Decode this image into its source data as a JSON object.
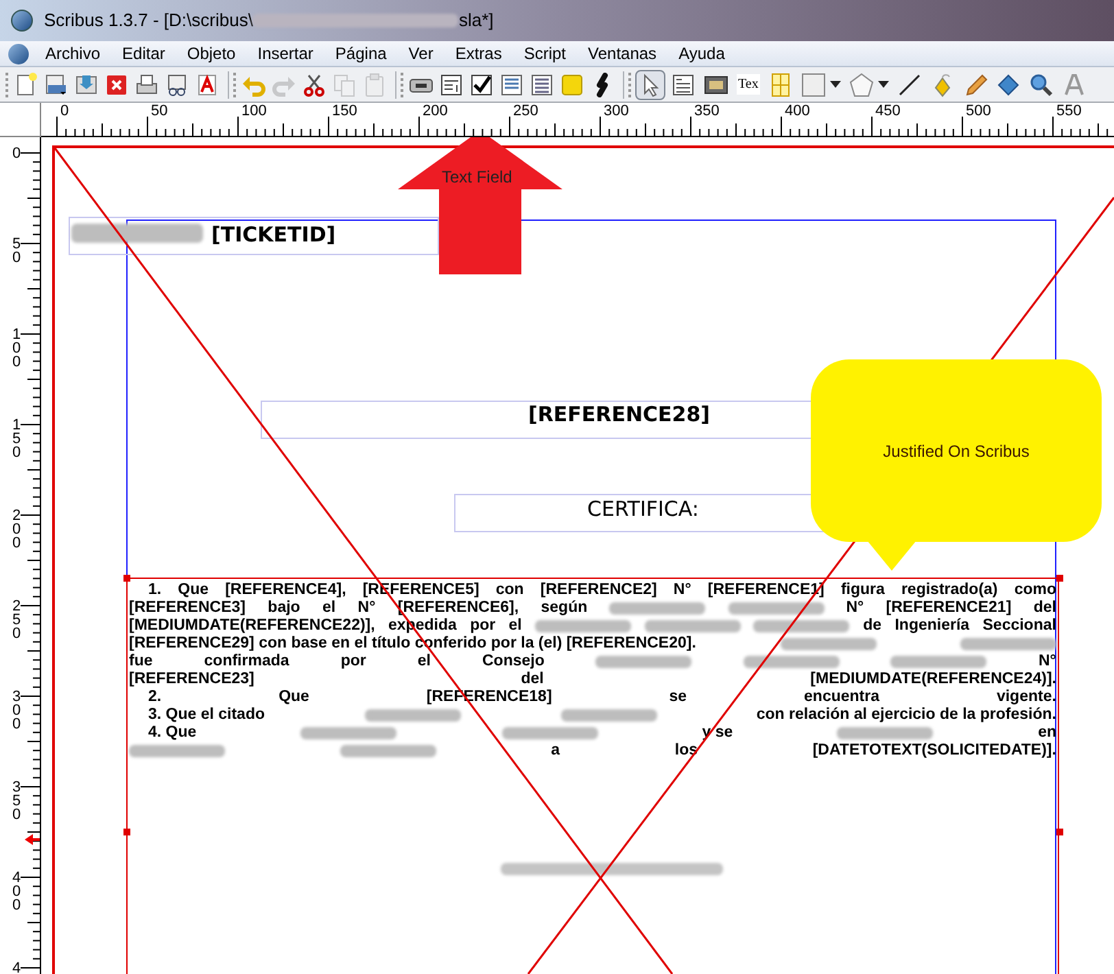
{
  "window": {
    "title_start": "Scribus 1.3.7 - [D:\\scribus\\",
    "title_end": "sla*]"
  },
  "menu": [
    "Archivo",
    "Editar",
    "Objeto",
    "Insertar",
    "Página",
    "Ver",
    "Extras",
    "Script",
    "Ventanas",
    "Ayuda"
  ],
  "toolbar": [
    [
      {
        "kind": "new"
      },
      {
        "kind": "open"
      },
      {
        "kind": "save"
      },
      {
        "kind": "close"
      },
      {
        "kind": "print"
      },
      {
        "kind": "preflight"
      },
      {
        "kind": "pdf"
      }
    ],
    [
      {
        "kind": "undo",
        "disabled": false
      },
      {
        "kind": "redo",
        "disabled": true
      },
      {
        "kind": "cut",
        "disabled": false
      },
      {
        "kind": "copy",
        "disabled": true
      },
      {
        "kind": "paste",
        "disabled": true
      }
    ],
    [
      {
        "kind": "pdf-button"
      },
      {
        "kind": "text-field"
      },
      {
        "kind": "checkbox"
      },
      {
        "kind": "combo-box"
      },
      {
        "kind": "list-box"
      },
      {
        "kind": "annotation"
      },
      {
        "kind": "link"
      }
    ],
    [
      {
        "kind": "select",
        "selected": true
      },
      {
        "kind": "text-frame",
        "selected": false
      },
      {
        "kind": "image-frame",
        "selected": false
      },
      {
        "kind": "latex",
        "label": "Tex",
        "selected": false
      },
      {
        "kind": "table",
        "selected": false
      },
      {
        "kind": "shape",
        "selected": false
      },
      {
        "kind": "polygon",
        "selected": false
      },
      {
        "kind": "line",
        "selected": false
      },
      {
        "kind": "bezier",
        "selected": false
      },
      {
        "kind": "freehand",
        "selected": false
      },
      {
        "kind": "rotate",
        "selected": false
      },
      {
        "kind": "zoom",
        "selected": false
      },
      {
        "kind": "edit-text",
        "selected": false
      }
    ]
  ],
  "rulers": {
    "horizontal": [
      "0",
      "50",
      "100",
      "150",
      "200",
      "250",
      "300",
      "350",
      "400",
      "450",
      "500",
      "550"
    ],
    "vertical": [
      "0",
      "50",
      "100",
      "150",
      "200",
      "250",
      "300",
      "350",
      "400",
      "4"
    ]
  },
  "page": {
    "ticket_field": "[TICKETID]",
    "arrow_label": "Text Field",
    "reference_field": "[REFERENCE28]",
    "certifica_field": "CERTIFICA:",
    "callout": "Justified On Scribus",
    "paragraph_lines": [
      {
        "indent": true,
        "segments": [
          {
            "kind": "text",
            "text": "1. Que [REFERENCE4], [REFERENCE5] con [REFERENCE2] N° [REFERENCE1] figura registrado(a) como"
          }
        ]
      },
      {
        "indent": false,
        "segments": [
          {
            "kind": "text",
            "text": "[REFERENCE3]"
          },
          {
            "kind": "text",
            "text": "bajo"
          },
          {
            "kind": "text",
            "text": "el"
          },
          {
            "kind": "text",
            "text": "N°"
          },
          {
            "kind": "text",
            "text": "[REFERENCE6],"
          },
          {
            "kind": "text",
            "text": "según"
          },
          {
            "kind": "blur"
          },
          {
            "kind": "blur"
          },
          {
            "kind": "text",
            "text": "N°"
          },
          {
            "kind": "text",
            "text": "[REFERENCE21]"
          },
          {
            "kind": "text",
            "text": "del"
          }
        ]
      },
      {
        "indent": false,
        "segments": [
          {
            "kind": "text",
            "text": "[MEDIUMDATE(REFERENCE22)],"
          },
          {
            "kind": "text",
            "text": "expedida"
          },
          {
            "kind": "text",
            "text": "por"
          },
          {
            "kind": "text",
            "text": "el"
          },
          {
            "kind": "blur"
          },
          {
            "kind": "blur"
          },
          {
            "kind": "blur"
          },
          {
            "kind": "text",
            "text": "de"
          },
          {
            "kind": "text",
            "text": "Ingeniería"
          },
          {
            "kind": "text",
            "text": "Seccional"
          }
        ]
      },
      {
        "indent": false,
        "segments": [
          {
            "kind": "text",
            "text": "[REFERENCE29] con base en el título conferido por la (el) [REFERENCE20]."
          },
          {
            "kind": "blur"
          },
          {
            "kind": "blur"
          }
        ]
      },
      {
        "indent": false,
        "segments": [
          {
            "kind": "text",
            "text": "fue"
          },
          {
            "kind": "text",
            "text": "confirmada"
          },
          {
            "kind": "text",
            "text": "por"
          },
          {
            "kind": "text",
            "text": "el"
          },
          {
            "kind": "text",
            "text": "Consejo"
          },
          {
            "kind": "blur"
          },
          {
            "kind": "blur"
          },
          {
            "kind": "blur"
          },
          {
            "kind": "text",
            "text": "N°"
          }
        ]
      },
      {
        "indent": false,
        "segments": [
          {
            "kind": "text",
            "text": "[REFERENCE23]"
          },
          {
            "kind": "text",
            "text": "del"
          },
          {
            "kind": "text",
            "text": "[MEDIUMDATE(REFERENCE24)]."
          }
        ]
      },
      {
        "indent": true,
        "segments": [
          {
            "kind": "text",
            "text": "2."
          },
          {
            "kind": "text",
            "text": "Que"
          },
          {
            "kind": "text",
            "text": "[REFERENCE18]"
          },
          {
            "kind": "text",
            "text": "se"
          },
          {
            "kind": "text",
            "text": "encuentra"
          },
          {
            "kind": "text",
            "text": "vigente."
          }
        ]
      },
      {
        "indent": true,
        "segments": [
          {
            "kind": "text",
            "text": "3. Que el citado"
          },
          {
            "kind": "blur"
          },
          {
            "kind": "blur"
          },
          {
            "kind": "text",
            "text": "con relación al ejercicio de la profesión."
          }
        ]
      },
      {
        "indent": true,
        "segments": [
          {
            "kind": "text",
            "text": "4. Que"
          },
          {
            "kind": "blur"
          },
          {
            "kind": "blur"
          },
          {
            "kind": "text",
            "text": "y se"
          },
          {
            "kind": "blur"
          },
          {
            "kind": "text",
            "text": "en"
          }
        ]
      },
      {
        "indent": false,
        "segments": [
          {
            "kind": "blur"
          },
          {
            "kind": "blur"
          },
          {
            "kind": "text",
            "text": "a"
          },
          {
            "kind": "text",
            "text": "los"
          },
          {
            "kind": "text",
            "text": "[DATETOTEXT(SOLICITEDATE)]."
          }
        ]
      }
    ]
  }
}
